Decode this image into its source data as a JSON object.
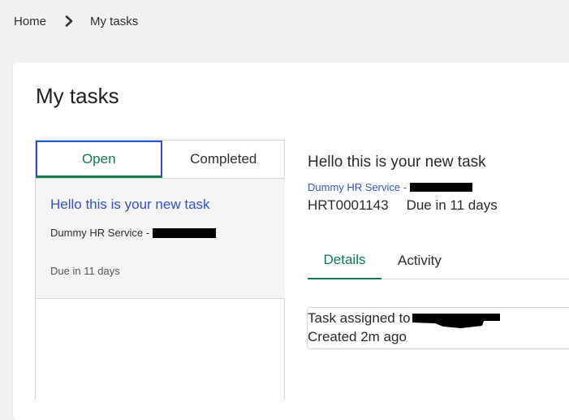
{
  "breadcrumb": {
    "home": "Home",
    "current": "My tasks"
  },
  "page": {
    "title": "My tasks"
  },
  "tabs": {
    "open": "Open",
    "completed": "Completed"
  },
  "task_list": [
    {
      "title": "Hello this is your new task",
      "service": "Dummy HR Service - ",
      "due": "Due in 11 days"
    }
  ],
  "detail": {
    "title": "Hello this is your new task",
    "service": "Dummy HR Service - ",
    "number": "HRT0001143",
    "due": "Due in 11 days",
    "tabs": {
      "details": "Details",
      "activity": "Activity"
    },
    "activity": {
      "assigned": "Task assigned to ",
      "created": "Created 2m ago"
    }
  },
  "colors": {
    "accent_green": "#137a4f",
    "link_blue": "#3553c6",
    "focus_border": "#2b4fcf",
    "redaction": "#000000"
  },
  "icons": {
    "breadcrumb_separator": "chevron-right-icon"
  }
}
